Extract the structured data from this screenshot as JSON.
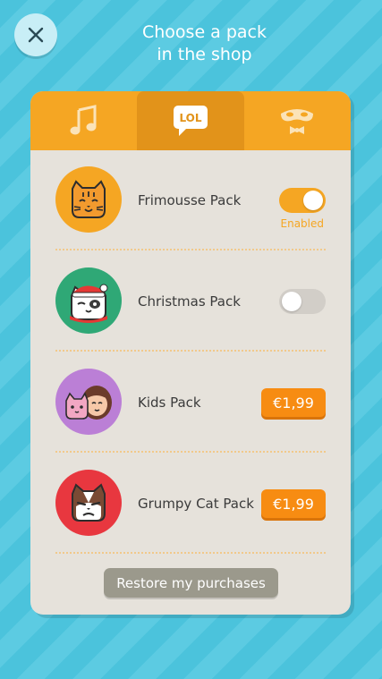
{
  "header": {
    "title_line1": "Choose a pack",
    "title_line2": "in the shop"
  },
  "tabs": [
    {
      "icon": "music-note-icon"
    },
    {
      "icon": "lol-bubble-icon",
      "text": "LOL",
      "active": true
    },
    {
      "icon": "mask-icon"
    }
  ],
  "packs": [
    {
      "name": "Frimousse Pack",
      "control": "toggle",
      "enabled": true,
      "status_label": "Enabled",
      "avatar_color": "#f5a623"
    },
    {
      "name": "Christmas Pack",
      "control": "toggle",
      "enabled": false,
      "avatar_color": "#2fa876"
    },
    {
      "name": "Kids Pack",
      "control": "price",
      "price": "€1,99",
      "avatar_color": "#bb7fd6"
    },
    {
      "name": "Grumpy Cat Pack",
      "control": "price",
      "price": "€1,99",
      "avatar_color": "#e8373f"
    }
  ],
  "restore_label": "Restore my purchases",
  "colors": {
    "background": "#4bc3dc",
    "accent": "#f5a623",
    "price_button": "#f78c12",
    "card": "#e6e2db",
    "restore_button": "#9b998c"
  }
}
